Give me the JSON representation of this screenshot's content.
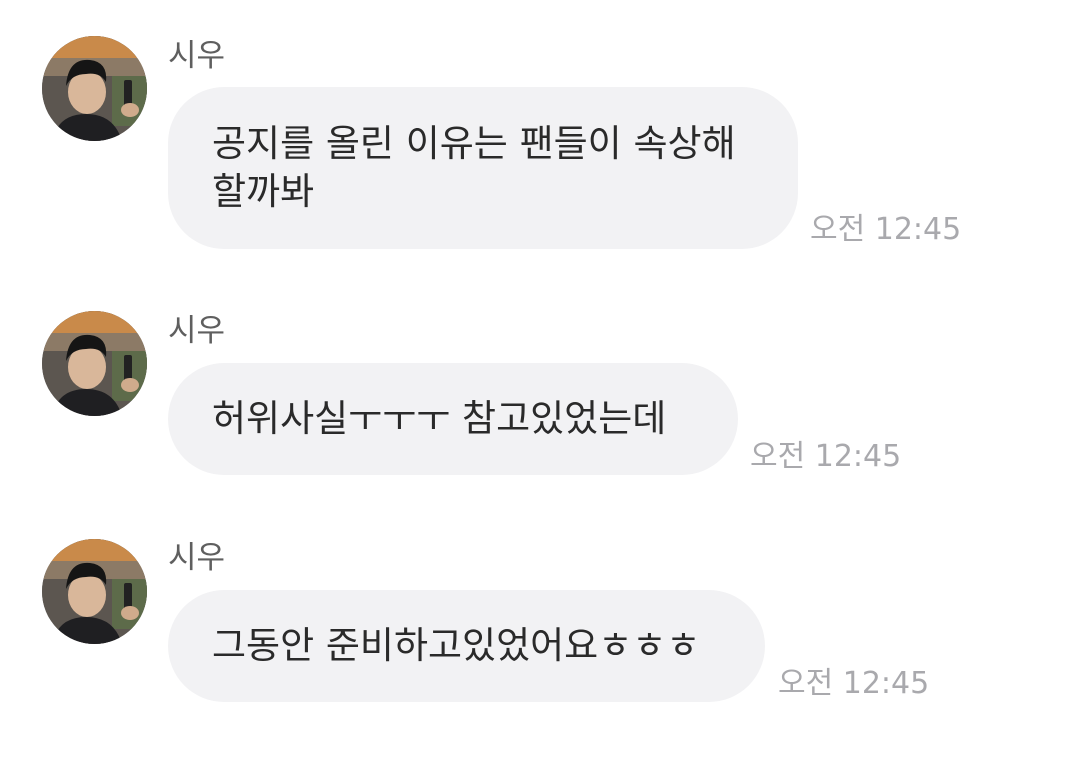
{
  "messages": [
    {
      "sender": "시우",
      "text": "공지를 올린 이유는 팬들이 속상해\n할까봐",
      "time": "오전 12:45"
    },
    {
      "sender": "시우",
      "text": "허위사실ㅜㅜㅜ 참고있었는데",
      "time": "오전 12:45"
    },
    {
      "sender": "시우",
      "text": "그동안 준비하고있었어요ㅎㅎㅎ",
      "time": "오전 12:45"
    }
  ]
}
